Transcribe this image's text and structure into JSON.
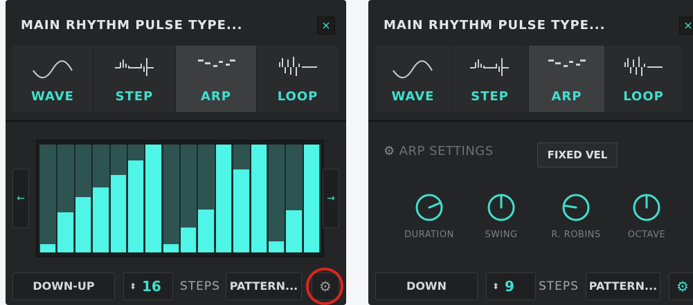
{
  "left_panel": {
    "title": "MAIN RHYTHM PULSE TYPE...",
    "close_label": "×",
    "types": [
      {
        "label": "WAVE",
        "icon": "wave-icon",
        "active": false
      },
      {
        "label": "STEP",
        "icon": "step-waveform-icon",
        "active": false
      },
      {
        "label": "ARP",
        "icon": "arp-pattern-icon",
        "active": true
      },
      {
        "label": "LOOP",
        "icon": "loop-waveform-icon",
        "active": false
      }
    ],
    "step_levels": [
      0.08,
      0.37,
      0.51,
      0.6,
      0.72,
      0.85,
      1.0,
      0.08,
      0.23,
      0.4,
      1.0,
      0.77,
      1.0,
      0.1,
      0.39,
      1.0
    ],
    "prev_arrow": "←",
    "next_arrow": "→",
    "direction_label": "DOWN-UP",
    "stepper_arrows": "⬍",
    "step_count": "16",
    "steps_label": "STEPS",
    "pattern_label": "PATTERN...",
    "settings_icon": "⚙",
    "highlight_color": "#d9261e"
  },
  "right_panel": {
    "title": "MAIN RHYTHM PULSE TYPE...",
    "close_label": "×",
    "types": [
      {
        "label": "WAVE",
        "icon": "wave-icon",
        "active": false
      },
      {
        "label": "STEP",
        "icon": "step-waveform-icon",
        "active": false
      },
      {
        "label": "ARP",
        "icon": "arp-pattern-icon",
        "active": true
      },
      {
        "label": "LOOP",
        "icon": "loop-waveform-icon",
        "active": false
      }
    ],
    "arp_settings_label": "ARP SETTINGS",
    "settings_icon": "⚙",
    "fixed_vel_label": "FIXED VEL",
    "knobs": [
      {
        "label": "DURATION",
        "value": 0.75
      },
      {
        "label": "SWING",
        "value": 0.5
      },
      {
        "label": "R. ROBINS",
        "value": 0.2
      },
      {
        "label": "OCTAVE",
        "value": 0.5
      }
    ],
    "direction_label": "DOWN",
    "stepper_arrows": "⬍",
    "step_count": "9",
    "steps_label": "STEPS",
    "pattern_label": "PATTERN..."
  },
  "colors": {
    "accent": "#3fe0d0",
    "bar": "#4ff5e6",
    "panel_bg": "#242526"
  }
}
